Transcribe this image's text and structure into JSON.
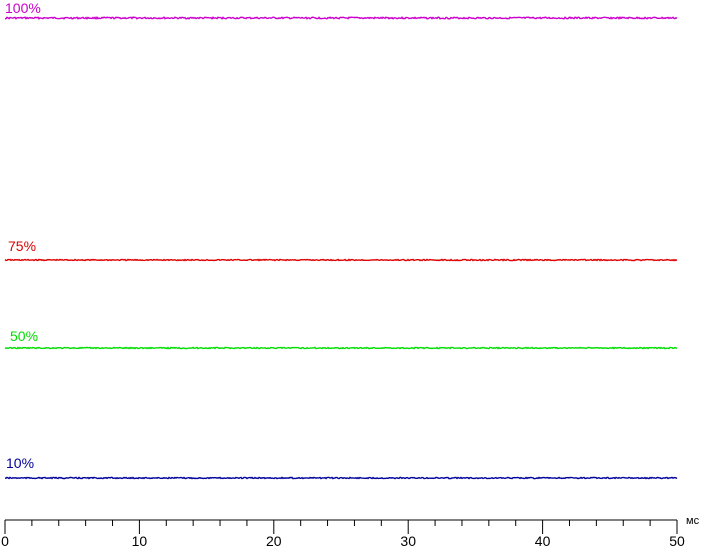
{
  "chart_data": {
    "type": "line",
    "title": "",
    "xlabel": "",
    "x_unit": "мс",
    "ylabel": "",
    "xlim": [
      0,
      50
    ],
    "x_ticks": [
      0,
      10,
      20,
      30,
      40,
      50
    ],
    "x_minor_step": 2,
    "y_axis_shown": false,
    "grid": false,
    "legend": "none",
    "series": [
      {
        "name": "100%",
        "level": 100,
        "color": "#cc00cc",
        "y_value": 100
      },
      {
        "name": "75%",
        "level": 75,
        "color": "#dd0000",
        "y_value": 75
      },
      {
        "name": "50%",
        "level": 50,
        "color": "#00dd00",
        "y_value": 50
      },
      {
        "name": "10%",
        "level": 10,
        "color": "#000099",
        "y_value": 10
      }
    ]
  }
}
